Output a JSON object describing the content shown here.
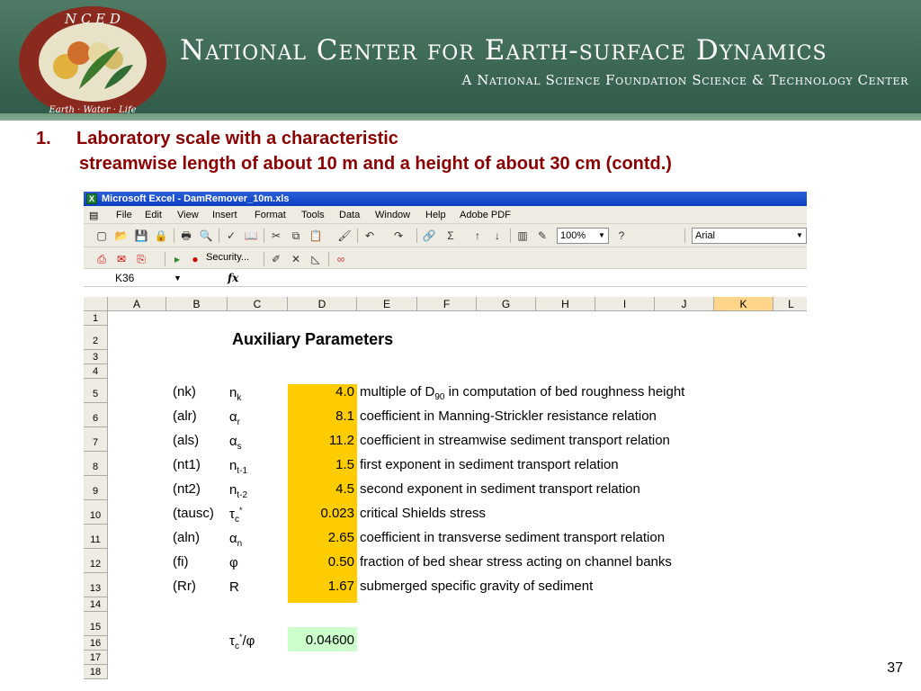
{
  "banner": {
    "title": "National Center for Earth-surface Dynamics",
    "subtitle": "A National Science Foundation Science & Technology Center",
    "logo_top": "N C E D",
    "logo_bottom": "Earth · Water · Life"
  },
  "heading": {
    "number": "1.",
    "line1": "Laboratory scale with a characteristic",
    "line2": "streamwise length of about 10 m and a height of about 30 cm (contd.)"
  },
  "excel": {
    "window_title": "Microsoft Excel - DamRemover_10m.xls",
    "menu": [
      "File",
      "Edit",
      "View",
      "Insert",
      "Format",
      "Tools",
      "Data",
      "Window",
      "Help",
      "Adobe PDF"
    ],
    "zoom": "100%",
    "font": "Arial",
    "security_label": "Security...",
    "name_box": "K36",
    "fx": "fx",
    "columns": [
      "A",
      "B",
      "C",
      "D",
      "E",
      "F",
      "G",
      "H",
      "I",
      "J",
      "K",
      "L"
    ],
    "selected_column": "K",
    "sheet_title": "Auxiliary Parameters",
    "rows": [
      "1",
      "2",
      "3",
      "4",
      "5",
      "6",
      "7",
      "8",
      "9",
      "10",
      "11",
      "12",
      "13",
      "14",
      "15",
      "16",
      "17",
      "18"
    ],
    "params": [
      {
        "code": "(nk)",
        "sym": "n",
        "sub": "k",
        "sup": "",
        "value": "4.0",
        "desc": "multiple of D",
        "desc_sub": "90",
        "desc_after": " in computation of bed roughness height"
      },
      {
        "code": "(alr)",
        "sym": "α",
        "sub": "r",
        "sup": "",
        "value": "8.1",
        "desc": "coefficient in Manning-Strickler resistance relation",
        "desc_sub": "",
        "desc_after": ""
      },
      {
        "code": "(als)",
        "sym": "α",
        "sub": "s",
        "sup": "",
        "value": "11.2",
        "desc": "coefficient in streamwise sediment transport relation",
        "desc_sub": "",
        "desc_after": ""
      },
      {
        "code": "(nt1)",
        "sym": "n",
        "sub": "t-1",
        "sup": "",
        "value": "1.5",
        "desc": "first exponent in sediment transport relation",
        "desc_sub": "",
        "desc_after": ""
      },
      {
        "code": "(nt2)",
        "sym": "n",
        "sub": "t-2",
        "sup": "",
        "value": "4.5",
        "desc": "second exponent in sediment transport relation",
        "desc_sub": "",
        "desc_after": ""
      },
      {
        "code": "(tausc)",
        "sym": "τ",
        "sub": "c",
        "sup": "*",
        "value": "0.023",
        "desc": "critical Shields stress",
        "desc_sub": "",
        "desc_after": ""
      },
      {
        "code": "(aln)",
        "sym": "α",
        "sub": "n",
        "sup": "",
        "value": "2.65",
        "desc": "coefficient in transverse sediment transport relation",
        "desc_sub": "",
        "desc_after": ""
      },
      {
        "code": "(fi)",
        "sym": "φ",
        "sub": "",
        "sup": "",
        "value": "0.50",
        "desc": "fraction of bed shear stress acting on channel banks",
        "desc_sub": "",
        "desc_after": ""
      },
      {
        "code": "(Rr)",
        "sym": "R",
        "sub": "",
        "sup": "",
        "value": "1.67",
        "desc": "submerged specific gravity of sediment",
        "desc_sub": "",
        "desc_after": ""
      }
    ],
    "ratio": {
      "sym": "τ",
      "sub": "c",
      "sup": "*",
      "tail": "/φ",
      "value": "0.04600"
    }
  },
  "page_number": "37"
}
